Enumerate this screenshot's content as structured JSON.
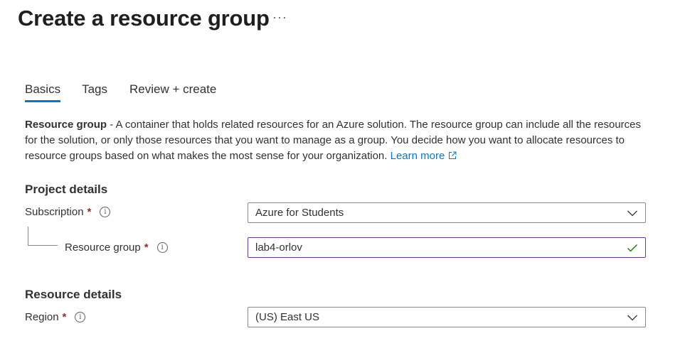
{
  "header": {
    "title": "Create a resource group",
    "more_label": "···"
  },
  "tabs": [
    {
      "label": "Basics",
      "active": true
    },
    {
      "label": "Tags",
      "active": false
    },
    {
      "label": "Review + create",
      "active": false
    }
  ],
  "description": {
    "bold": "Resource group",
    "text": " - A container that holds related resources for an Azure solution. The resource group can include all the resources for the solution, or only those resources that you want to manage as a group. You decide how you want to allocate resources to resource groups based on what makes the most sense for your organization. ",
    "link": "Learn more"
  },
  "project_details": {
    "heading": "Project details",
    "subscription": {
      "label": "Subscription",
      "required_mark": "*",
      "value": "Azure for Students"
    },
    "resource_group": {
      "label": "Resource group",
      "required_mark": "*",
      "value": "lab4-orlov"
    }
  },
  "resource_details": {
    "heading": "Resource details",
    "region": {
      "label": "Region",
      "required_mark": "*",
      "value": "(US) East US"
    }
  },
  "icons": {
    "info": "info-icon",
    "chevron": "chevron-down-icon",
    "check": "checkmark-icon",
    "external": "external-link-icon"
  },
  "colors": {
    "accent": "#0078d4",
    "required": "#a4262c",
    "valid": "#107c10",
    "focus_border": "#6a3a91"
  }
}
